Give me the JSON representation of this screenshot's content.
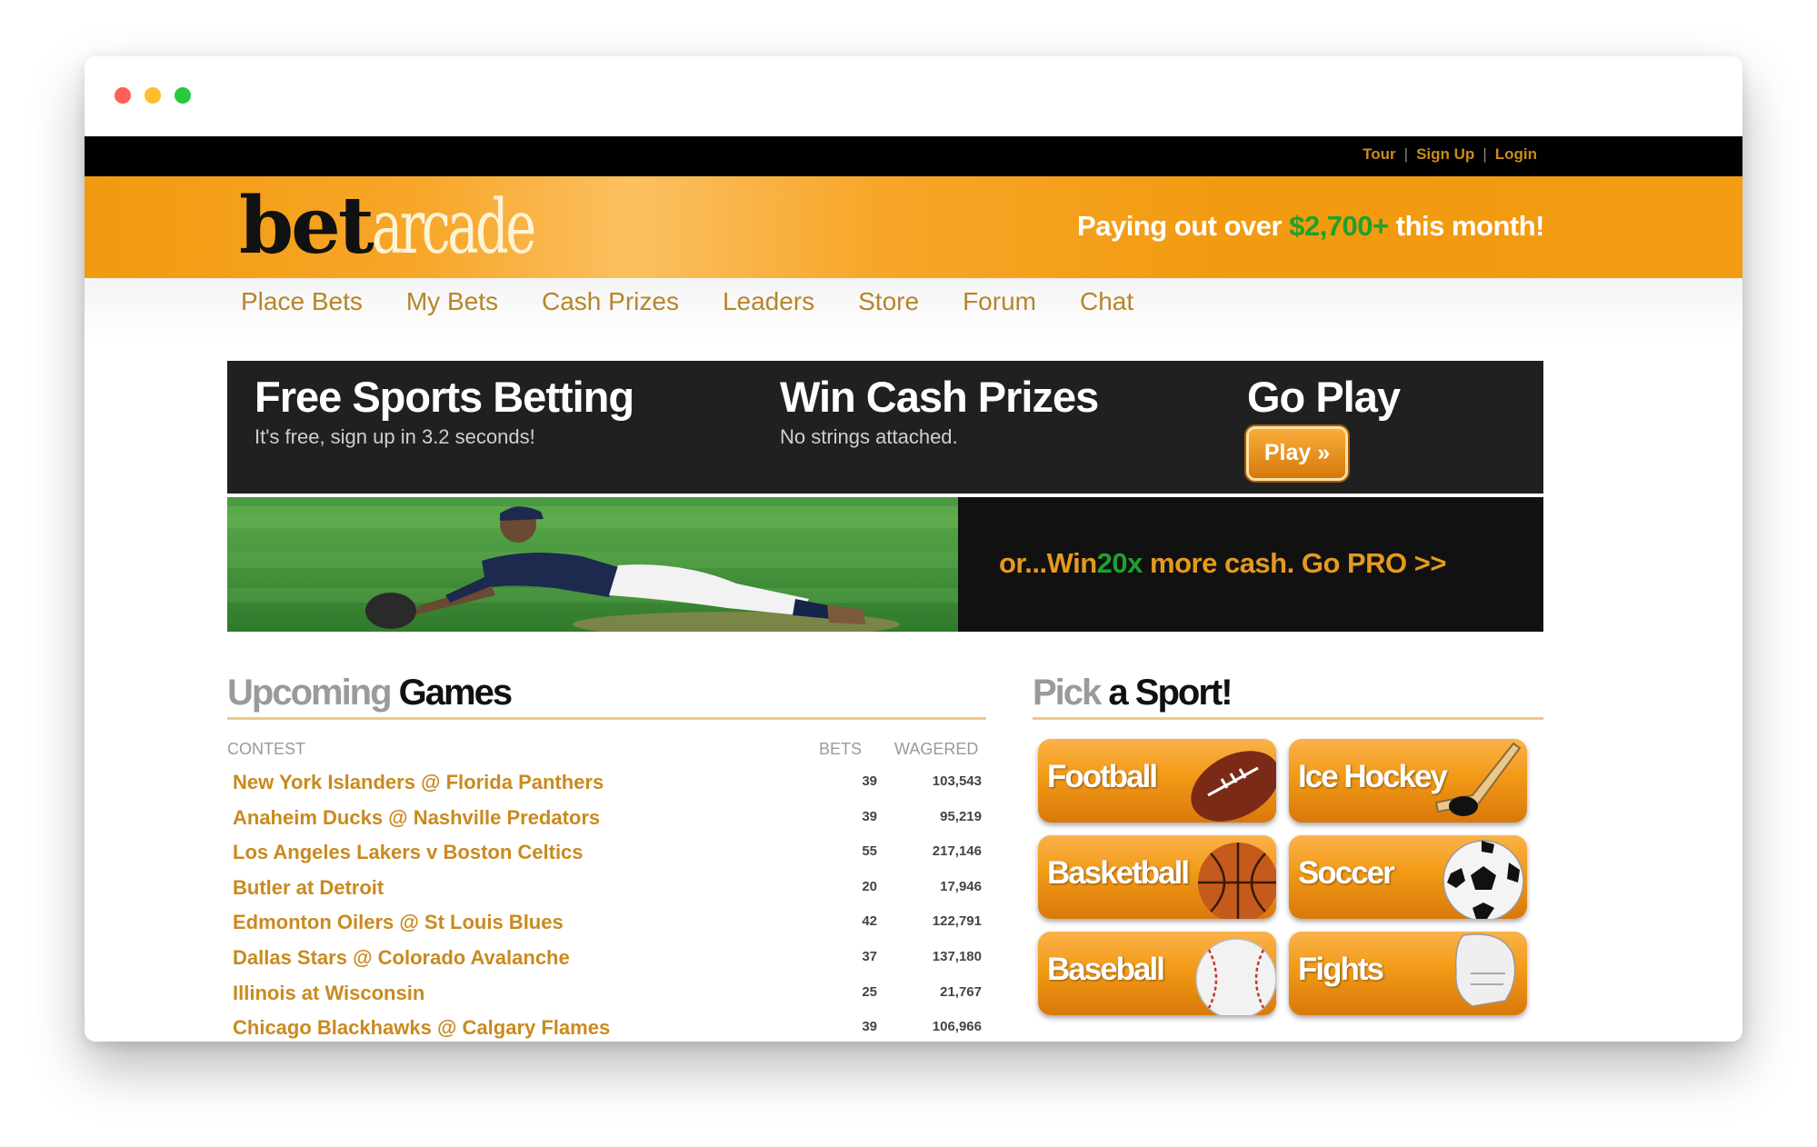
{
  "window": {
    "controls": [
      "close",
      "minimize",
      "maximize"
    ]
  },
  "toplinks": {
    "tour": "Tour",
    "signup": "Sign Up",
    "login": "Login",
    "separator": "|"
  },
  "header": {
    "logo_bet": "bet",
    "logo_arcade": "arcade",
    "payout_prefix": "Paying out over",
    "payout_amount": "$2,700+",
    "payout_suffix": "this month!"
  },
  "nav": [
    "Place Bets",
    "My Bets",
    "Cash Prizes",
    "Leaders",
    "Store",
    "Forum",
    "Chat"
  ],
  "promo": {
    "col1_title": "Free Sports Betting",
    "col1_sub": "It's free, sign up in 3.2 seconds!",
    "col2_title": "Win Cash Prizes",
    "col2_sub": "No strings attached.",
    "col3_title": "Go Play",
    "play_button": "Play »"
  },
  "gopro": {
    "prefix": "or...Win",
    "highlight": "20x",
    "suffix": "more cash. Go PRO >>"
  },
  "upcoming": {
    "title_light": "Upcoming",
    "title_dark": "Games",
    "headers": {
      "contest": "CONTEST",
      "bets": "BETS",
      "wagered": "WAGERED"
    },
    "rows": [
      {
        "contest": "New York Islanders @ Florida Panthers",
        "bets": "39",
        "wagered": "103,543"
      },
      {
        "contest": "Anaheim Ducks @ Nashville Predators",
        "bets": "39",
        "wagered": "95,219"
      },
      {
        "contest": "Los Angeles Lakers v Boston Celtics",
        "bets": "55",
        "wagered": "217,146"
      },
      {
        "contest": "Butler at Detroit",
        "bets": "20",
        "wagered": "17,946"
      },
      {
        "contest": "Edmonton Oilers @ St Louis Blues",
        "bets": "42",
        "wagered": "122,791"
      },
      {
        "contest": "Dallas Stars @ Colorado Avalanche",
        "bets": "37",
        "wagered": "137,180"
      },
      {
        "contest": "Illinois at Wisconsin",
        "bets": "25",
        "wagered": "21,767"
      },
      {
        "contest": "Chicago Blackhawks @ Calgary Flames",
        "bets": "39",
        "wagered": "106,966"
      }
    ]
  },
  "pick": {
    "title_light": "Pick",
    "title_mid": "a",
    "title_dark": "Sport!",
    "sports": [
      {
        "label": "Football",
        "icon": "football-icon"
      },
      {
        "label": "Ice Hockey",
        "icon": "hockey-icon"
      },
      {
        "label": "Basketball",
        "icon": "basketball-icon"
      },
      {
        "label": "Soccer",
        "icon": "soccer-ball-icon"
      },
      {
        "label": "Baseball",
        "icon": "baseball-icon"
      },
      {
        "label": "Fights",
        "icon": "boxing-glove-icon"
      }
    ]
  },
  "colors": {
    "brand_orange": "#f29a10",
    "link_gold": "#c98a1f",
    "accent_green": "#1ea12e",
    "promo_dark": "#202020"
  }
}
